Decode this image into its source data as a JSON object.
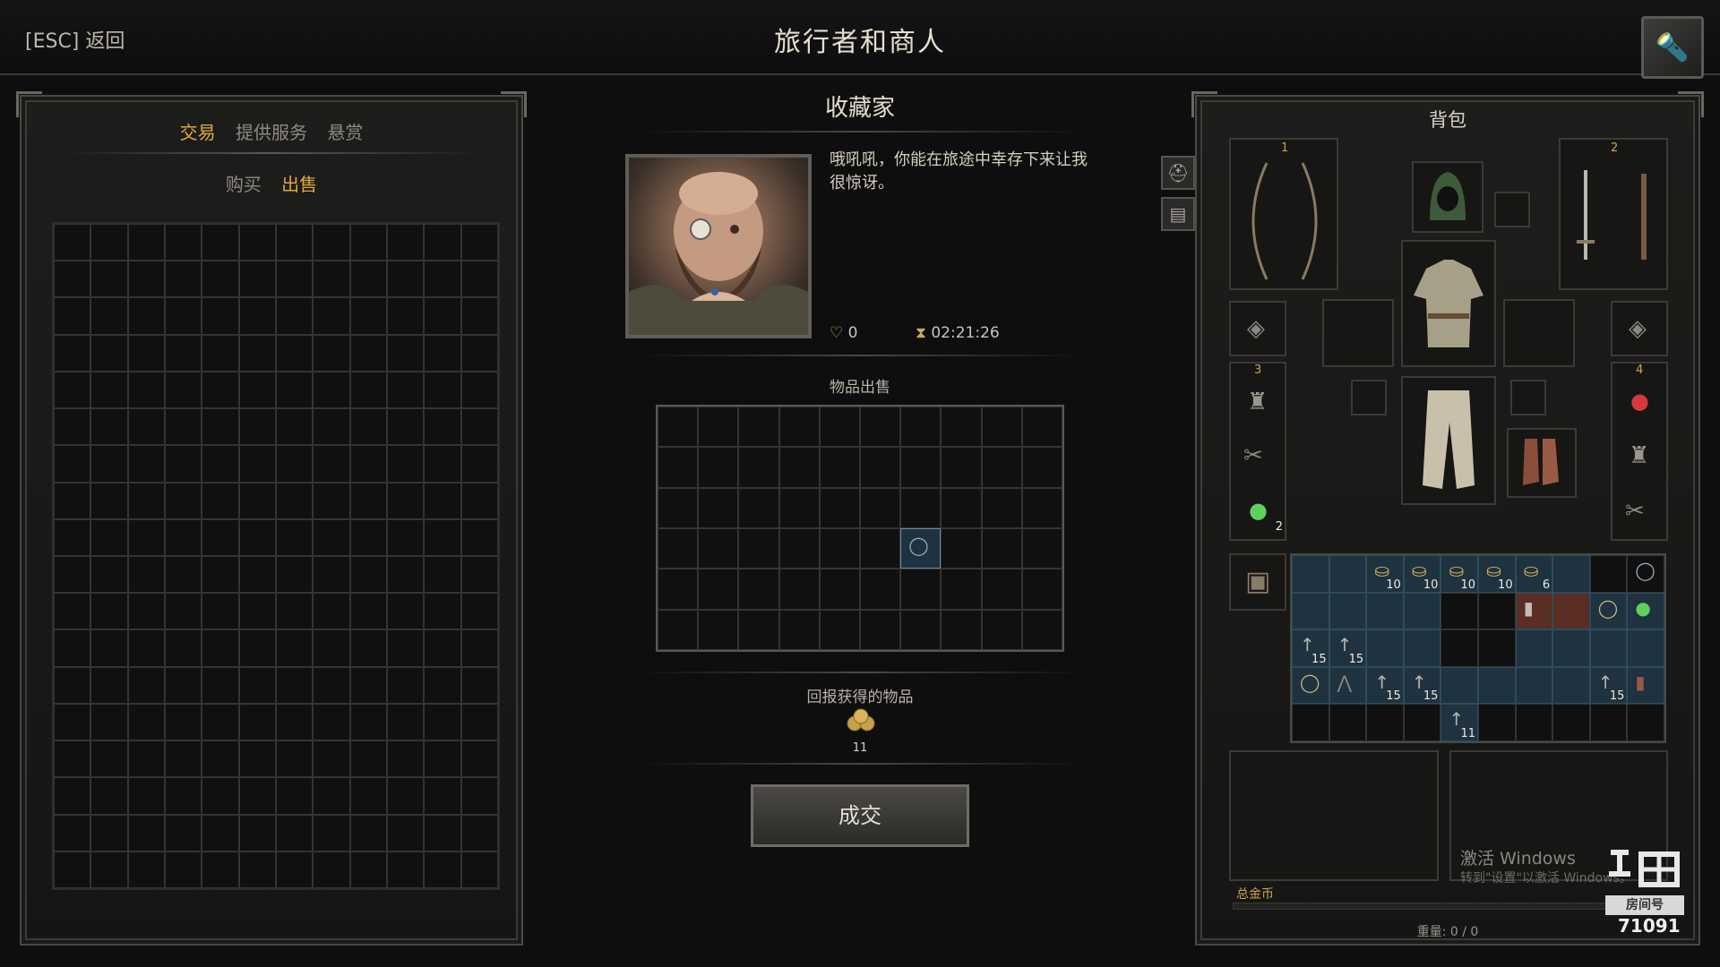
{
  "header": {
    "back": "[ESC] 返回",
    "title": "旅行者和商人"
  },
  "left_panel": {
    "tabs": [
      {
        "label": "交易",
        "active": true
      },
      {
        "label": "提供服务",
        "active": false
      },
      {
        "label": "悬赏",
        "active": false
      }
    ],
    "sub_tabs": [
      {
        "label": "购买",
        "active": false
      },
      {
        "label": "出售",
        "active": true
      }
    ]
  },
  "merchant": {
    "name": "收藏家",
    "dialogue": "哦吼吼，你能在旅途中幸存下来让我很惊讶。",
    "favor": "0",
    "timer": "02:21:26"
  },
  "trade": {
    "sell_label": "物品出售",
    "reward_label": "回报获得的物品",
    "reward_count": "11",
    "deal_button": "成交"
  },
  "backpack": {
    "title": "背包",
    "weapon_set_1": "1",
    "weapon_set_2": "2",
    "quick_slot_3": "3",
    "quick_slot_4": "4",
    "potion_count": "2",
    "coin_stacks": [
      "10",
      "10",
      "10",
      "10",
      "6"
    ],
    "arrow_counts": [
      "15",
      "15",
      "15",
      "15",
      "11",
      "15"
    ],
    "total_gold_label": "总金币",
    "weight": "重量: 0 / 0"
  },
  "overlay": {
    "windows_activate": "激活 Windows",
    "windows_sub": "转到\"设置\"以激活 Windows。",
    "room_number": "71091",
    "logo_text": "房间号"
  },
  "colors": {
    "accent": "#e0a93a",
    "frame": "#4a4945",
    "inventory_cell": "#1e3240"
  },
  "icons": [
    "helmet-icon",
    "chest-icon",
    "heart-favor-icon",
    "hourglass-icon",
    "gold-coin-icon",
    "arrow-icon",
    "ring-icon",
    "lantern-icon",
    "potion-icon",
    "boots-icon"
  ]
}
